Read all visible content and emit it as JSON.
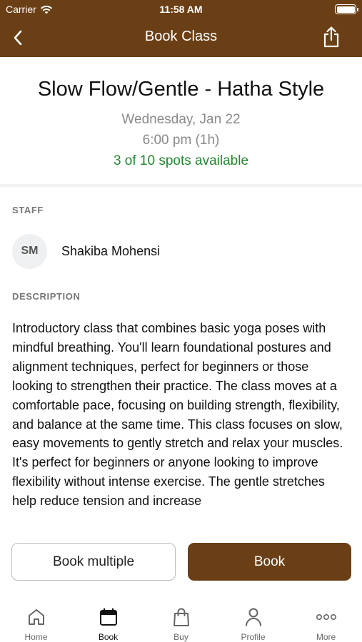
{
  "status_bar": {
    "carrier": "Carrier",
    "time": "11:58 AM",
    "battery_level": 1.0
  },
  "nav": {
    "title": "Book Class",
    "back_icon": "chevron-left-icon",
    "share_icon": "share-icon"
  },
  "class": {
    "title": "Slow Flow/Gentle - Hatha Style",
    "date": "Wednesday, Jan 22",
    "time": "6:00 pm (1h)",
    "spots": "3 of 10 spots available"
  },
  "staff": {
    "label": "STAFF",
    "initials": "SM",
    "name": "Shakiba Mohensi"
  },
  "description": {
    "label": "DESCRIPTION",
    "text": "Introductory class that combines basic yoga poses with mindful breathing. You'll learn foundational postures and alignment techniques, perfect for beginners or those looking to strengthen their practice. The class moves at a comfortable pace, focusing on building strength, flexibility, and balance at the same time. This class focuses on slow, easy movements to gently stretch and relax your muscles. It's perfect for beginners or anyone looking to improve flexibility without intense exercise. The gentle stretches help reduce tension and increase"
  },
  "actions": {
    "book_multiple": "Book multiple",
    "book": "Book"
  },
  "tabs": [
    {
      "label": "Home",
      "icon": "home-icon",
      "active": false
    },
    {
      "label": "Book",
      "icon": "calendar-icon",
      "active": true
    },
    {
      "label": "Buy",
      "icon": "shopping-bag-icon",
      "active": false
    },
    {
      "label": "Profile",
      "icon": "person-icon",
      "active": false
    },
    {
      "label": "More",
      "icon": "more-dots-icon",
      "active": false
    }
  ],
  "colors": {
    "brand": "#6b3f15",
    "available": "#23862e",
    "muted": "#8a8a8a"
  }
}
